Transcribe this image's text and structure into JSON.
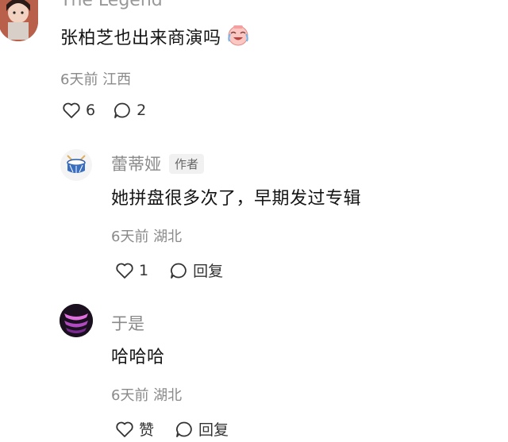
{
  "comments": [
    {
      "username": "The Legend",
      "text": "张柏芝也出来商演吗",
      "emoji_icon": "crying-laughing-emoji-icon",
      "meta": "6天前 江西",
      "likes": "6",
      "replies": "2"
    },
    {
      "username": "蕾蒂娅",
      "author_tag": "作者",
      "text": "她拼盘很多次了，早期发过专辑",
      "meta": "6天前 湖北",
      "likes": "1",
      "reply_label": "回复"
    },
    {
      "username": "于是",
      "text": "哈哈哈",
      "meta": "6天前 湖北",
      "like_label": "赞",
      "reply_label": "回复"
    }
  ],
  "colors": {
    "meta_gray": "#8a8a8a",
    "text_dark": "#141414",
    "tag_bg": "#f1f1f1",
    "drum_blue": "#3a6fc0"
  }
}
